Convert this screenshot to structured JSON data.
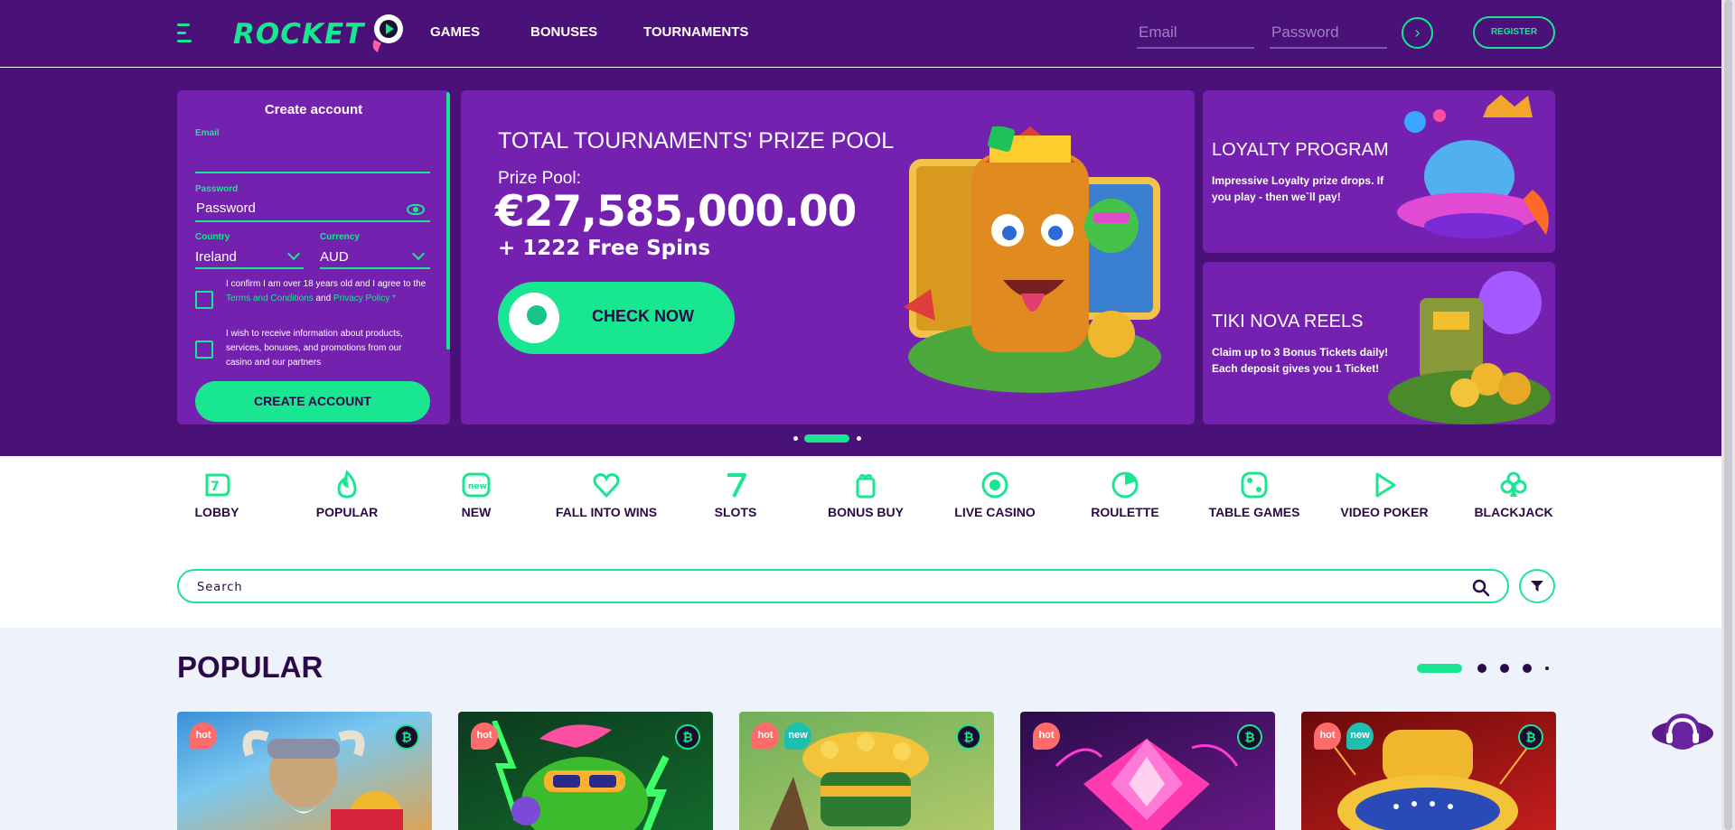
{
  "header": {
    "logo": "ROCKET",
    "nav": [
      "GAMES",
      "BONUSES",
      "TOURNAMENTS"
    ],
    "email_placeholder": "Email",
    "password_placeholder": "Password",
    "go_arrow": "›",
    "register_label": "REGISTER"
  },
  "signup": {
    "title": "Create account",
    "email_label": "Email",
    "password_label": "Password",
    "password_value": "Password",
    "country_label": "Country",
    "country_value": "Ireland",
    "currency_label": "Currency",
    "currency_value": "AUD",
    "age_text_1": "I confirm I am over 18 years old and I agree to the ",
    "age_link_terms": "Terms and Conditions",
    "age_text_2": " and ",
    "age_link_privacy": "Privacy Policy *",
    "marketing_text": "I wish to receive information about products, services, bonuses, and promotions from our casino and our partners",
    "create_button": "CREATE ACCOUNT"
  },
  "banner": {
    "title": "TOTAL TOURNAMENTS' PRIZE POOL",
    "prize_label": "Prize Pool:",
    "amount": "€27,585,000.00",
    "spins": "+ 1222 Free Spins",
    "cta": "CHECK NOW",
    "active_slide": 2,
    "slide_count": 3
  },
  "promos": [
    {
      "title": "LOYALTY PROGRAM",
      "desc": "Impressive Loyalty prize drops. If you play - then we`ll pay!"
    },
    {
      "title": "TIKI NOVA REELS",
      "desc": "Claim up to 3 Bonus Tickets daily! Each deposit gives you 1 Ticket!"
    }
  ],
  "categories": [
    {
      "label": "LOBBY",
      "icon": "lobby-icon"
    },
    {
      "label": "POPULAR",
      "icon": "flame-icon"
    },
    {
      "label": "NEW",
      "icon": "new-icon"
    },
    {
      "label": "FALL INTO WINS",
      "icon": "heart-icon"
    },
    {
      "label": "SLOTS",
      "icon": "seven-icon"
    },
    {
      "label": "BONUS BUY",
      "icon": "gift-icon"
    },
    {
      "label": "LIVE CASINO",
      "icon": "live-icon"
    },
    {
      "label": "ROULETTE",
      "icon": "roulette-icon"
    },
    {
      "label": "TABLE GAMES",
      "icon": "dice-icon"
    },
    {
      "label": "VIDEO POKER",
      "icon": "play-icon"
    },
    {
      "label": "BLACKJACK",
      "icon": "club-icon"
    }
  ],
  "search": {
    "placeholder": "Search"
  },
  "popular": {
    "title": "POPULAR",
    "pages": 5,
    "active_page": 1,
    "cards": [
      {
        "badges": [
          "hot"
        ],
        "crypto": "₿"
      },
      {
        "badges": [
          "hot"
        ],
        "crypto": "₿"
      },
      {
        "badges": [
          "hot",
          "new"
        ],
        "crypto": "₿"
      },
      {
        "badges": [
          "hot"
        ],
        "crypto": "₿"
      },
      {
        "badges": [
          "hot",
          "new"
        ],
        "crypto": "₿"
      }
    ]
  },
  "colors": {
    "accent": "#19e690",
    "header_bg": "#4a1178",
    "panel_bg": "#7421b0",
    "text_dark": "#2b0a4a"
  }
}
